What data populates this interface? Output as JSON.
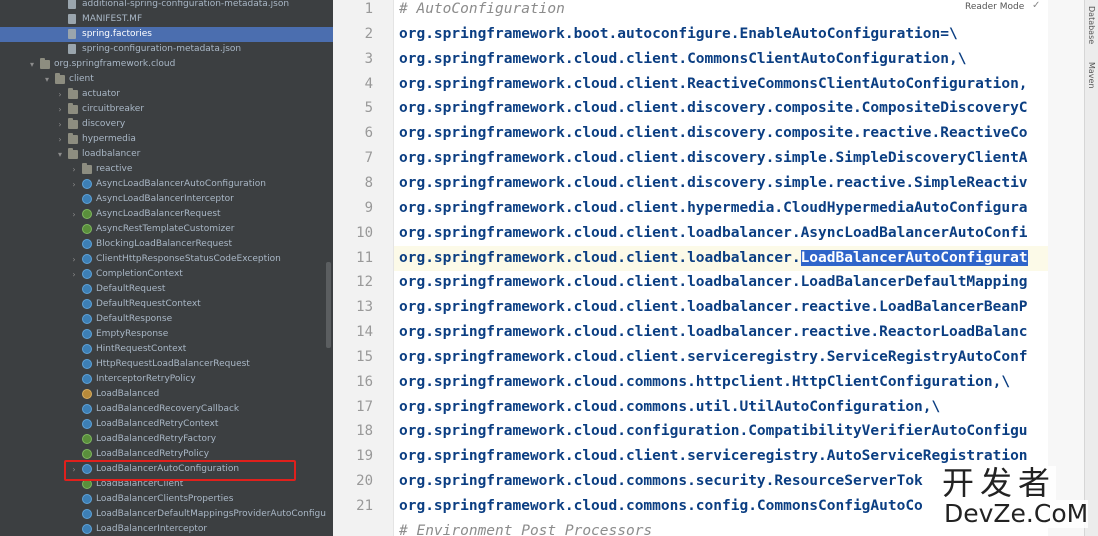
{
  "tree": {
    "rows": [
      {
        "label": "additional-spring-configuration-metadata.json",
        "icon": "json-file-icon",
        "arrow": ""
      },
      {
        "label": "MANIFEST.MF",
        "icon": "manifest-file-icon",
        "arrow": ""
      },
      {
        "label": "spring.factories",
        "icon": "factories-file-icon",
        "arrow": "",
        "selected": true
      },
      {
        "label": "spring-configuration-metadata.json",
        "icon": "json-file-icon",
        "arrow": ""
      },
      {
        "label": "org.springframework.cloud",
        "icon": "package-icon",
        "arrow": "▾"
      },
      {
        "label": "client",
        "icon": "package-icon",
        "arrow": "▾"
      },
      {
        "label": "actuator",
        "icon": "package-icon",
        "arrow": "›"
      },
      {
        "label": "circuitbreaker",
        "icon": "package-icon",
        "arrow": "›"
      },
      {
        "label": "discovery",
        "icon": "package-icon",
        "arrow": "›"
      },
      {
        "label": "hypermedia",
        "icon": "package-icon",
        "arrow": "›"
      },
      {
        "label": "loadbalancer",
        "icon": "package-icon",
        "arrow": "▾"
      },
      {
        "label": "reactive",
        "icon": "package-icon",
        "arrow": "›"
      },
      {
        "label": "AsyncLoadBalancerAutoConfiguration",
        "icon": "class-icon",
        "arrow": "›"
      },
      {
        "label": "AsyncLoadBalancerInterceptor",
        "icon": "class-icon",
        "arrow": ""
      },
      {
        "label": "AsyncLoadBalancerRequest",
        "icon": "interface-icon",
        "arrow": "›"
      },
      {
        "label": "AsyncRestTemplateCustomizer",
        "icon": "interface-icon",
        "arrow": ""
      },
      {
        "label": "BlockingLoadBalancerRequest",
        "icon": "class-icon",
        "arrow": ""
      },
      {
        "label": "ClientHttpResponseStatusCodeException",
        "icon": "class-icon",
        "arrow": "›"
      },
      {
        "label": "CompletionContext",
        "icon": "class-icon",
        "arrow": "›"
      },
      {
        "label": "DefaultRequest",
        "icon": "class-icon",
        "arrow": ""
      },
      {
        "label": "DefaultRequestContext",
        "icon": "class-icon",
        "arrow": ""
      },
      {
        "label": "DefaultResponse",
        "icon": "class-icon",
        "arrow": ""
      },
      {
        "label": "EmptyResponse",
        "icon": "class-icon",
        "arrow": ""
      },
      {
        "label": "HintRequestContext",
        "icon": "class-icon",
        "arrow": ""
      },
      {
        "label": "HttpRequestLoadBalancerRequest",
        "icon": "class-icon",
        "arrow": ""
      },
      {
        "label": "InterceptorRetryPolicy",
        "icon": "class-icon",
        "arrow": ""
      },
      {
        "label": "LoadBalanced",
        "icon": "annotation-icon",
        "arrow": ""
      },
      {
        "label": "LoadBalancedRecoveryCallback",
        "icon": "class-icon",
        "arrow": ""
      },
      {
        "label": "LoadBalancedRetryContext",
        "icon": "class-icon",
        "arrow": ""
      },
      {
        "label": "LoadBalancedRetryFactory",
        "icon": "interface-icon",
        "arrow": ""
      },
      {
        "label": "LoadBalancedRetryPolicy",
        "icon": "interface-icon",
        "arrow": ""
      },
      {
        "label": "LoadBalancerAutoConfiguration",
        "icon": "class-icon",
        "arrow": "›",
        "highlighted": true
      },
      {
        "label": "LoadBalancerClient",
        "icon": "interface-icon",
        "arrow": ""
      },
      {
        "label": "LoadBalancerClientsProperties",
        "icon": "class-icon",
        "arrow": ""
      },
      {
        "label": "LoadBalancerDefaultMappingsProviderAutoConfigu",
        "icon": "class-icon",
        "arrow": ""
      },
      {
        "label": "LoadBalancerInterceptor",
        "icon": "class-icon",
        "arrow": ""
      }
    ]
  },
  "editor": {
    "reader_mode": "Reader Mode",
    "lines": [
      {
        "n": "1",
        "text": "# AutoConfiguration",
        "comment": true
      },
      {
        "n": "2",
        "text": "org.springframework.boot.autoconfigure.EnableAutoConfiguration=\\"
      },
      {
        "n": "3",
        "text": "org.springframework.cloud.client.CommonsClientAutoConfiguration,\\"
      },
      {
        "n": "4",
        "text": "org.springframework.cloud.client.ReactiveCommonsClientAutoConfiguration,"
      },
      {
        "n": "5",
        "text": "org.springframework.cloud.client.discovery.composite.CompositeDiscoveryC"
      },
      {
        "n": "6",
        "text": "org.springframework.cloud.client.discovery.composite.reactive.ReactiveCo"
      },
      {
        "n": "7",
        "text": "org.springframework.cloud.client.discovery.simple.SimpleDiscoveryClientA"
      },
      {
        "n": "8",
        "text": "org.springframework.cloud.client.discovery.simple.reactive.SimpleReactiv"
      },
      {
        "n": "9",
        "text": "org.springframework.cloud.client.hypermedia.CloudHypermediaAutoConfigura"
      },
      {
        "n": "10",
        "text": "org.springframework.cloud.client.loadbalancer.AsyncLoadBalancerAutoConfi"
      },
      {
        "n": "11",
        "text": "org.springframework.cloud.client.loadbalancer.",
        "sel": "LoadBalancerAutoConfigurat"
      },
      {
        "n": "12",
        "text": "org.springframework.cloud.client.loadbalancer.LoadBalancerDefaultMapping"
      },
      {
        "n": "13",
        "text": "org.springframework.cloud.client.loadbalancer.reactive.LoadBalancerBeanP"
      },
      {
        "n": "14",
        "text": "org.springframework.cloud.client.loadbalancer.reactive.ReactorLoadBalanc"
      },
      {
        "n": "15",
        "text": "org.springframework.cloud.client.serviceregistry.ServiceRegistryAutoConf"
      },
      {
        "n": "16",
        "text": "org.springframework.cloud.commons.httpclient.HttpClientConfiguration,\\"
      },
      {
        "n": "17",
        "text": "org.springframework.cloud.commons.util.UtilAutoConfiguration,\\"
      },
      {
        "n": "18",
        "text": "org.springframework.cloud.configuration.CompatibilityVerifierAutoConfigu"
      },
      {
        "n": "19",
        "text": "org.springframework.cloud.client.serviceregistry.AutoServiceRegistration"
      },
      {
        "n": "20",
        "text": "org.springframework.cloud.commons.security.ResourceServerTok"
      },
      {
        "n": "21",
        "text": "org.springframework.cloud.commons.config.CommonsConfigAutoCo"
      },
      {
        "n": "",
        "text": "# Environment Post Processors",
        "comment": true
      }
    ]
  },
  "right_tabs": [
    "Database",
    "Maven"
  ],
  "watermark": {
    "cn": "开发者",
    "en": "DevZe.CoM"
  }
}
